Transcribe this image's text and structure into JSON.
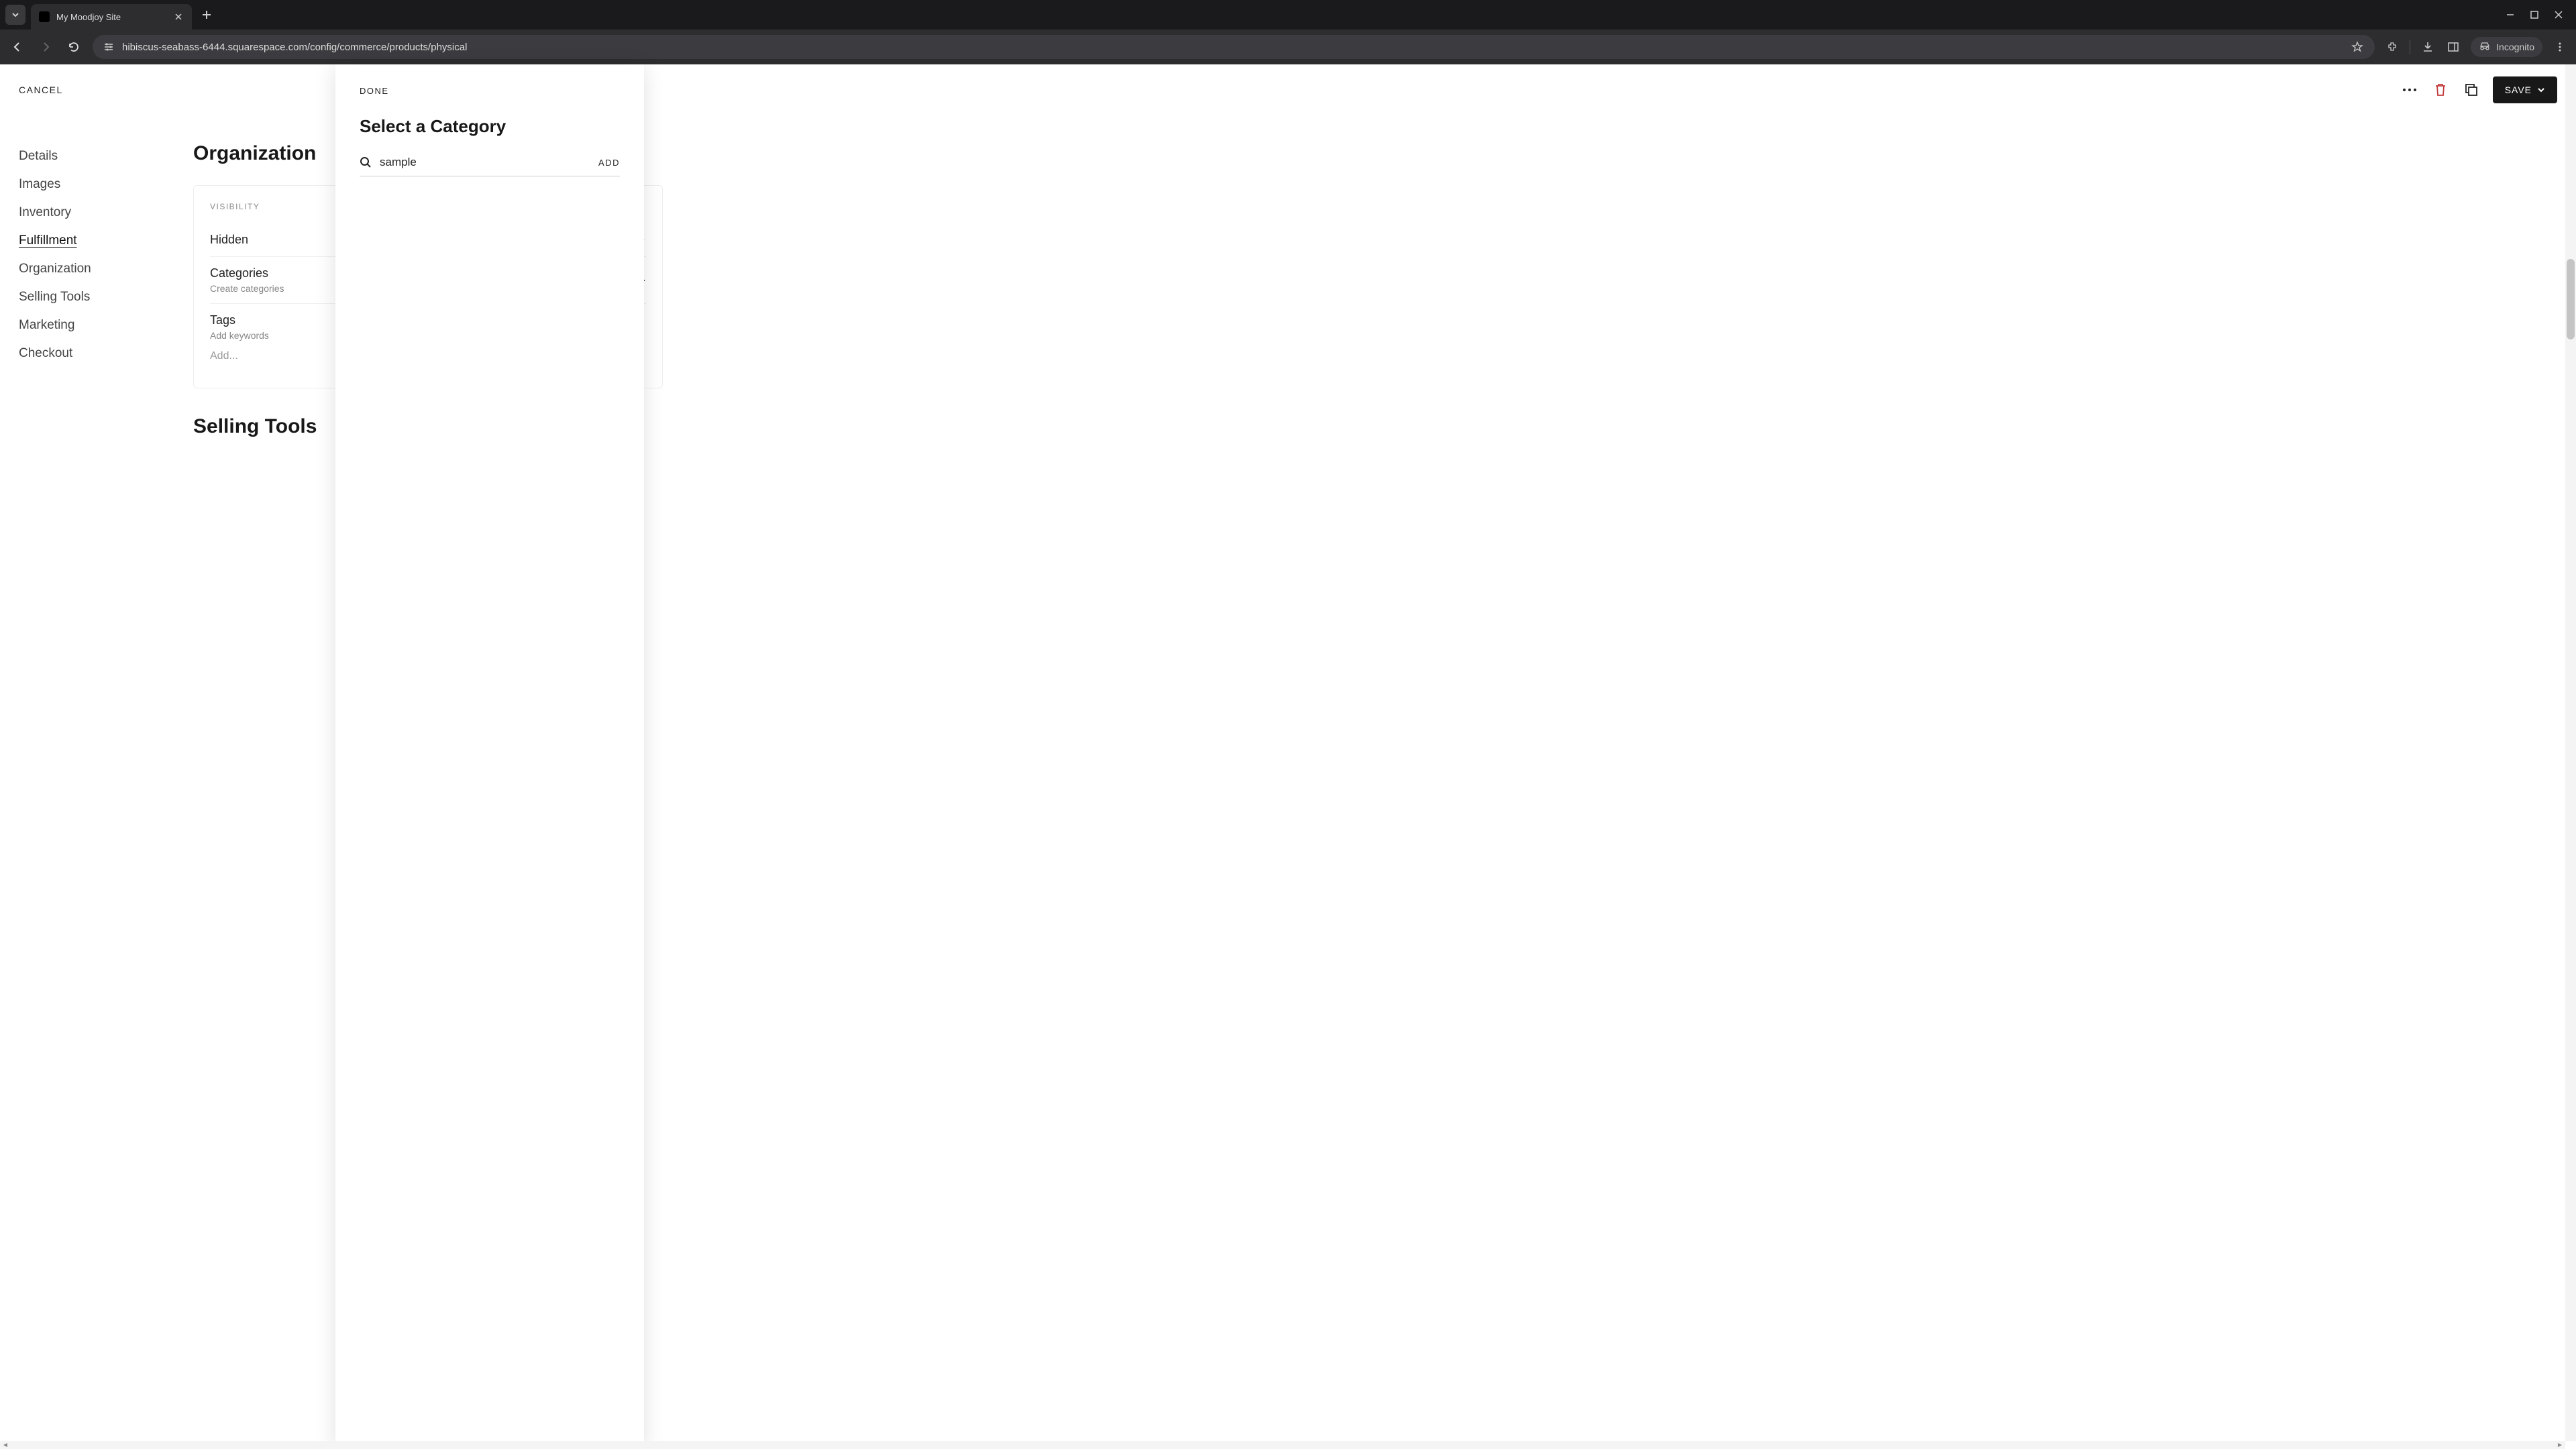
{
  "browser": {
    "tab_title": "My Moodjoy Site",
    "url": "hibiscus-seabass-6444.squarespace.com/config/commerce/products/physical",
    "incognito_label": "Incognito"
  },
  "header": {
    "cancel": "CANCEL",
    "save": "SAVE"
  },
  "sidebar": {
    "items": [
      {
        "label": "Details"
      },
      {
        "label": "Images"
      },
      {
        "label": "Inventory"
      },
      {
        "label": "Fulfillment"
      },
      {
        "label": "Organization"
      },
      {
        "label": "Selling Tools"
      },
      {
        "label": "Marketing"
      },
      {
        "label": "Checkout"
      }
    ],
    "active_index": 3
  },
  "sections": {
    "organization": {
      "title": "Organization",
      "visibility_label": "VISIBILITY",
      "visibility_value": "Hidden",
      "categories_label": "Categories",
      "categories_sub": "Create categories",
      "categories_sub_tail": ".",
      "tags_label": "Tags",
      "tags_sub": "Add keywords",
      "tags_placeholder": "Add..."
    },
    "selling_tools": {
      "title": "Selling Tools"
    }
  },
  "modal": {
    "done": "DONE",
    "title": "Select a Category",
    "search_value": "sample",
    "add_button": "ADD"
  }
}
